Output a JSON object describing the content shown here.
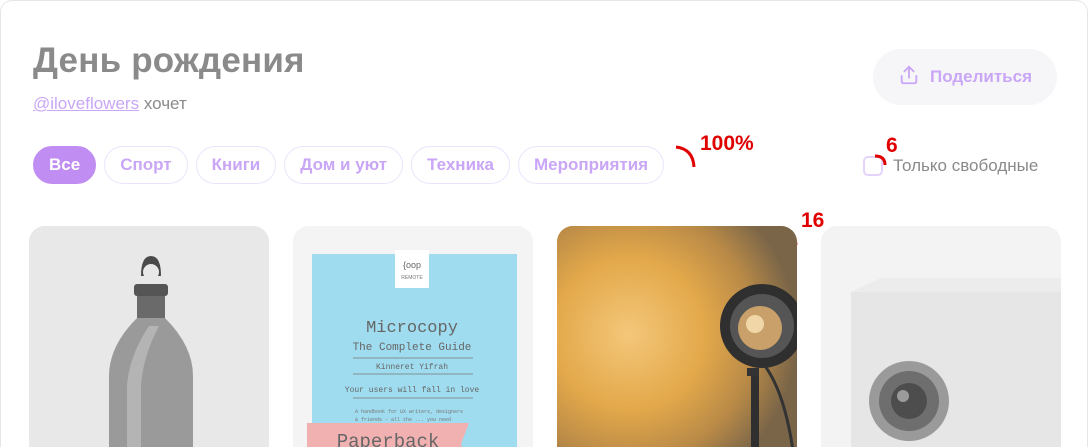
{
  "header": {
    "title": "День рождения",
    "username": "@iloveflowers",
    "wants_text": "хочет",
    "share_label": "Поделиться"
  },
  "filters": {
    "chips": [
      {
        "label": "Все",
        "active": true
      },
      {
        "label": "Спорт",
        "active": false
      },
      {
        "label": "Книги",
        "active": false
      },
      {
        "label": "Дом и уют",
        "active": false
      },
      {
        "label": "Техника",
        "active": false
      },
      {
        "label": "Мероприятия",
        "active": false
      }
    ],
    "only_free_label": "Только свободные",
    "only_free_checked": false
  },
  "annotations": {
    "radius_chip": "100%",
    "radius_checkbox": "6",
    "radius_card": "16"
  },
  "cards": [
    {
      "image": "water-bottle"
    },
    {
      "image": "book-cover",
      "book_brand": "{oop",
      "book_brand_sub": "REMOTE",
      "book_title": "Microcopy",
      "book_subtitle": "The Complete Guide",
      "book_author": "Kinneret Yifrah",
      "book_tagline": "Your users will fall in love",
      "book_line_a": "A handbook for UX writers, designers",
      "book_line_b": "& friends - all the ... you need",
      "book_ribbon": "Paperback"
    },
    {
      "image": "sunset-lamp"
    },
    {
      "image": "projector"
    }
  ],
  "colors": {
    "accent": "#c08ef3",
    "accent_text": "#c9a6f6",
    "annotation": "#e10000",
    "muted_text": "#8a8a8a"
  }
}
